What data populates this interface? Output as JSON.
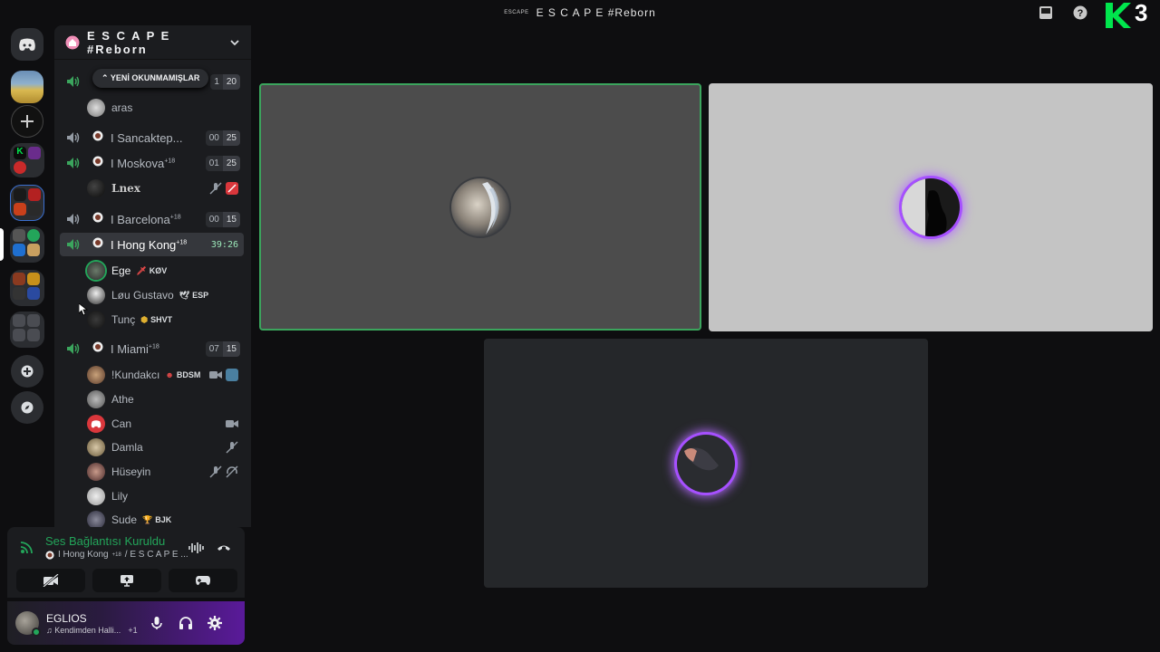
{
  "window": {
    "title": "E S C A P E #Reborn",
    "mini_logo": "ESCAPE",
    "overlay_brand": "3"
  },
  "icons": {
    "inbox": "inbox-icon",
    "help": "help-icon",
    "overlay": "k3-overlay-logo"
  },
  "server": {
    "name": "E S C A P E #Reborn"
  },
  "new_unreads": "YENİ OKUNMAMIŞLAR",
  "channels": [
    {
      "name": "",
      "counts": [
        "1",
        "20"
      ]
    },
    {
      "name": "I Sancaktep...",
      "counts": [
        "00",
        "25"
      ]
    },
    {
      "name": "I Moskova",
      "sup": "+18",
      "counts": [
        "01",
        "25"
      ]
    },
    {
      "name": "I Barcelona",
      "sup": "+18",
      "counts": [
        "00",
        "15"
      ]
    },
    {
      "name": "I Hong Kong",
      "sup": "+18",
      "timer": "39:26"
    },
    {
      "name": "I Miami",
      "sup": "+18",
      "counts": [
        "07",
        "15"
      ]
    }
  ],
  "users": {
    "aras": {
      "name": "aras"
    },
    "lnex": {
      "name": "Lnex"
    },
    "ege": {
      "name": "Ege",
      "tag": "KØV"
    },
    "lou": {
      "name": "Løu Gustavo",
      "tag": "ESP"
    },
    "tunc": {
      "name": "Tunç",
      "tag": "SHVT"
    },
    "kundakci": {
      "name": "!Kundakcı",
      "tag": "BDSM"
    },
    "athe": {
      "name": "Athe"
    },
    "can": {
      "name": "Can"
    },
    "damla": {
      "name": "Damla"
    },
    "huseyin": {
      "name": "Hüseyin"
    },
    "lily": {
      "name": "Lily"
    },
    "sude": {
      "name": "Sude",
      "tag": "BJK"
    }
  },
  "voice": {
    "status": "Ses Bağlantısı Kuruldu",
    "channel_path": "I Hong Kong",
    "sup": "+18",
    "path_rest": "/ E S C A P E ..."
  },
  "account": {
    "name": "EGLIOS",
    "activity": "Kendimden Halli...",
    "extra": "+1"
  },
  "colors": {
    "accent_green": "#23a55a",
    "speaking_border": "#3ba55d",
    "glow": "#a650ff"
  }
}
